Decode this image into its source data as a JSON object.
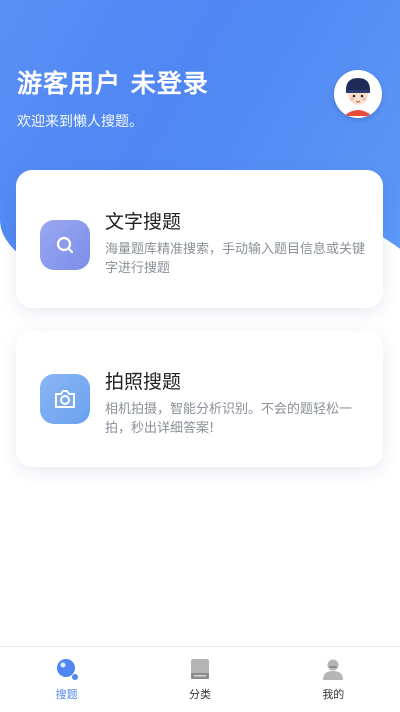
{
  "header": {
    "title": "游客用户 未登录",
    "subtitle": "欢迎来到懒人搜题。"
  },
  "cards": [
    {
      "title": "文字搜题",
      "description": "海量题库精准搜索，手动输入题目信息或关键字进行搜题",
      "icon": "search-icon"
    },
    {
      "title": "拍照搜题",
      "description": "相机拍摄，智能分析识别。不会的题轻松一拍，秒出详细答案!",
      "icon": "camera-icon"
    }
  ],
  "tabbar": {
    "items": [
      {
        "label": "搜题",
        "icon": "search-tab-icon",
        "active": true
      },
      {
        "label": "分类",
        "icon": "book-icon",
        "active": false
      },
      {
        "label": "我的",
        "icon": "user-icon",
        "active": false
      }
    ]
  },
  "colors": {
    "primary": "#4f86f2",
    "header_gradient_start": "#5a8ff5",
    "header_gradient_end": "#5d9af7",
    "text_dark": "#222222",
    "text_muted": "#8a8f99"
  }
}
